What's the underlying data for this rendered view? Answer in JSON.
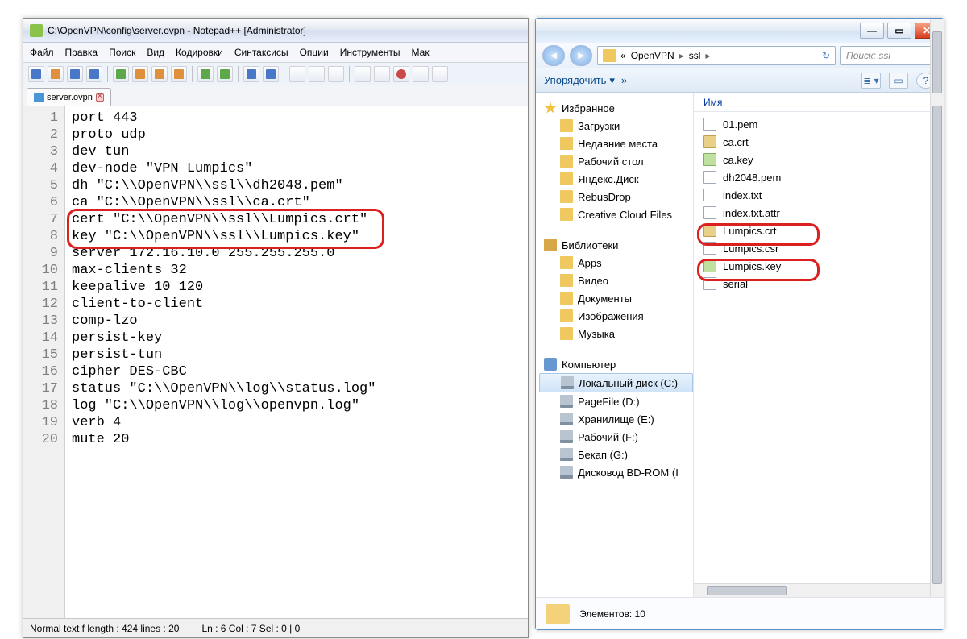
{
  "npp": {
    "title": "C:\\OpenVPN\\config\\server.ovpn - Notepad++ [Administrator]",
    "menus": [
      "Файл",
      "Правка",
      "Поиск",
      "Вид",
      "Кодировки",
      "Синтаксисы",
      "Опции",
      "Инструменты",
      "Мак"
    ],
    "tab": "server.ovpn",
    "lines": [
      "port 443",
      "proto udp",
      "dev tun",
      "dev-node \"VPN Lumpics\"",
      "dh \"C:\\\\OpenVPN\\\\ssl\\\\dh2048.pem\"",
      "ca \"C:\\\\OpenVPN\\\\ssl\\\\ca.crt\"",
      "cert \"C:\\\\OpenVPN\\\\ssl\\\\Lumpics.crt\"",
      "key \"C:\\\\OpenVPN\\\\ssl\\\\Lumpics.key\"",
      "server 172.16.10.0 255.255.255.0",
      "max-clients 32",
      "keepalive 10 120",
      "client-to-client",
      "comp-lzo",
      "persist-key",
      "persist-tun",
      "cipher DES-CBC",
      "status \"C:\\\\OpenVPN\\\\log\\\\status.log\"",
      "log \"C:\\\\OpenVPN\\\\log\\\\openvpn.log\"",
      "verb 4",
      "mute 20"
    ],
    "status": {
      "left": "Normal text f  length : 424     lines : 20",
      "right": "Ln : 6    Col : 7    Sel : 0 | 0"
    }
  },
  "explorer": {
    "crumb_prefix": "«",
    "crumb1": "OpenVPN",
    "crumb2": "ssl",
    "search_placeholder": "Поиск: ssl",
    "organize": "Упорядочить",
    "column_name": "Имя",
    "item_count_label": "Элементов: 10",
    "nav": {
      "favorites": "Избранное",
      "fav_items": [
        "Загрузки",
        "Недавние места",
        "Рабочий стол",
        "Яндекс.Диск",
        "RebusDrop",
        "Creative Cloud Files"
      ],
      "libraries": "Библиотеки",
      "lib_items": [
        "Apps",
        "Видео",
        "Документы",
        "Изображения",
        "Музыка"
      ],
      "computer": "Компьютер",
      "comp_items": [
        "Локальный диск (C:)",
        "PageFile (D:)",
        "Хранилище (E:)",
        "Рабочий (F:)",
        "Бекап (G:)",
        "Дисковод BD-ROM (I"
      ]
    },
    "files": [
      "01.pem",
      "ca.crt",
      "ca.key",
      "dh2048.pem",
      "index.txt",
      "index.txt.attr",
      "Lumpics.crt",
      "Lumpics.csr",
      "Lumpics.key",
      "serial"
    ]
  },
  "winbtn": {
    "min": "—",
    "max": "▭",
    "close": "✕"
  }
}
